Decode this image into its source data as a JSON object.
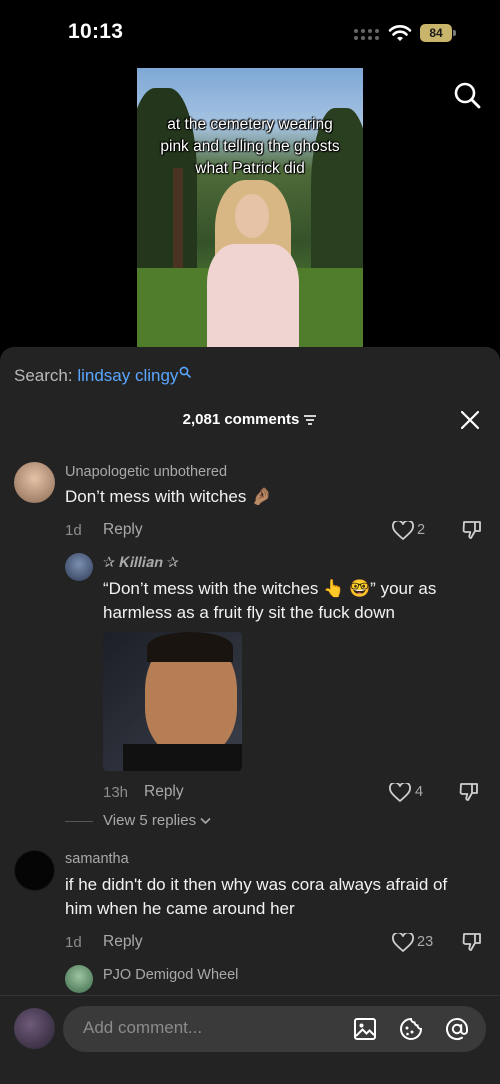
{
  "status_bar": {
    "time": "10:13",
    "battery": "84"
  },
  "video": {
    "caption_lines": [
      "at the cemetery wearing",
      "pink and telling the ghosts",
      "what Patrick did"
    ]
  },
  "search": {
    "prefix": "Search:",
    "term": "lindsay clingy"
  },
  "comments_header": {
    "count_label": "2,081 comments"
  },
  "comments": [
    {
      "username": "Unapologetic unbothered",
      "text": "Don’t mess with witches 🤌🏽",
      "age": "1d",
      "reply_label": "Reply",
      "likes": "2"
    },
    {
      "username": "✰ 𝑲𝒊𝒍𝒍𝒊𝒂𝒏 ✰",
      "text_line1": "“Don’t mess with the witches 👆 🤓” your as",
      "text_line2": "harmless as a fruit fly sit the fuck down",
      "age": "13h",
      "reply_label": "Reply",
      "likes": "4"
    },
    {
      "username": "samantha",
      "text_line1": "if he didn't do it then why was cora always afraid of",
      "text_line2": "him when he came around her",
      "age": "1d",
      "reply_label": "Reply",
      "likes": "23"
    },
    {
      "username": "PJO Demigod Wheel"
    }
  ],
  "view_replies": "View 5 replies",
  "composer": {
    "placeholder": "Add comment..."
  },
  "colors": {
    "link": "#5aa6ff",
    "sheet_bg": "#232323",
    "battery": "#c8b46a"
  },
  "icons": [
    "search-icon",
    "filter-icon",
    "close-icon",
    "heart-icon",
    "dislike-icon",
    "image-icon",
    "emoji-icon",
    "at-icon",
    "wifi-icon"
  ]
}
